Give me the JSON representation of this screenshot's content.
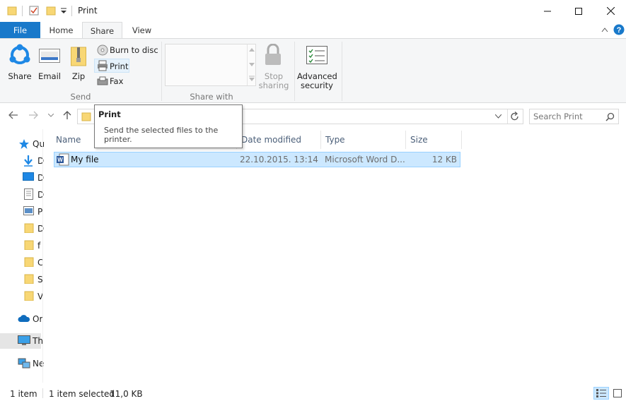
{
  "window": {
    "title": "Print"
  },
  "ribbon_tabs": {
    "file": "File",
    "home": "Home",
    "share": "Share",
    "view": "View"
  },
  "ribbon": {
    "share_btn": "Share",
    "email_btn": "Email",
    "zip_btn": "Zip",
    "burn_btn": "Burn to disc",
    "print_btn": "Print",
    "fax_btn": "Fax",
    "send_group": "Send",
    "share_with_group": "Share with",
    "stop_sharing_line1": "Stop",
    "stop_sharing_line2": "sharing",
    "advanced_security_line1": "Advanced",
    "advanced_security_line2": "security"
  },
  "search": {
    "placeholder": "Search Print"
  },
  "tooltip": {
    "title": "Print",
    "body_line1": "Send the selected files to the",
    "body_line2": "printer."
  },
  "nav_pane": {
    "quick_access": "Qu",
    "downloads": "D",
    "desktop": "D",
    "documents": "D",
    "pictures": "P",
    "folder1": "D",
    "folder2": "f",
    "folder3": "C",
    "folder4": "S",
    "folder5": "V",
    "onedrive": "Or",
    "this_pc": "Th",
    "network": "Ne"
  },
  "columns": {
    "name": "Name",
    "date_modified": "Date modified",
    "type": "Type",
    "size": "Size"
  },
  "files": [
    {
      "name": "My file",
      "date": "22.10.2015. 13:14",
      "type": "Microsoft Word D...",
      "size": "12 KB"
    }
  ],
  "status": {
    "count": "1 item",
    "selected": "1 item selected",
    "selected_size": "11,0 KB"
  },
  "colors": {
    "accent": "#1979ca",
    "selection": "#cce8ff",
    "selection_border": "#99d1ff",
    "folder": "#f8d775"
  }
}
